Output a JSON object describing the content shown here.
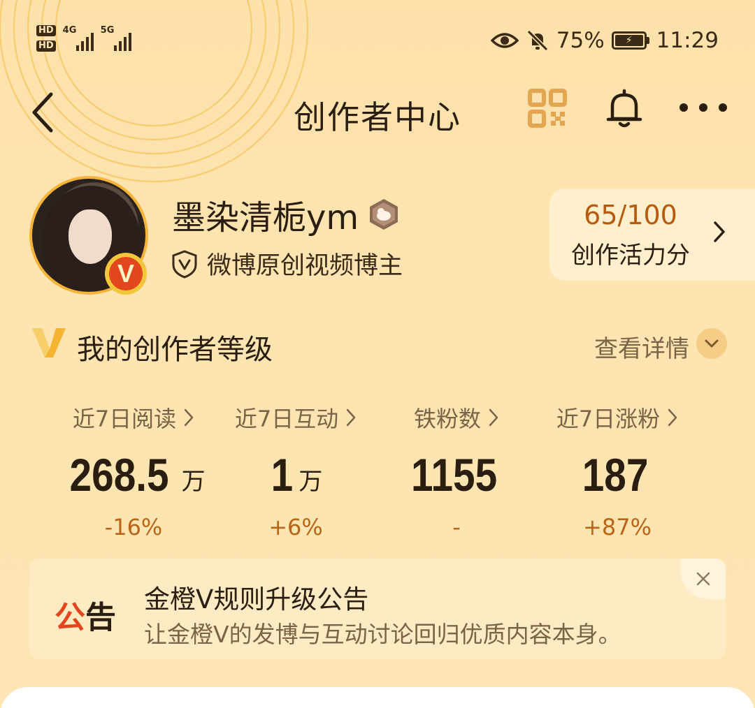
{
  "status_bar": {
    "hd1": "HD",
    "hd2": "HD",
    "net1": "4G",
    "net2": "5G",
    "battery_percent": "75%",
    "time": "11:29"
  },
  "nav": {
    "title": "创作者中心"
  },
  "profile": {
    "username": "墨染清栀ym",
    "verified_badge": "V",
    "verification": "微博原创视频博主"
  },
  "vitality": {
    "score": "65/100",
    "label": "创作活力分"
  },
  "level": {
    "title": "我的创作者等级",
    "detail_label": "查看详情"
  },
  "stats": [
    {
      "label": "近7日阅读",
      "value": "268.5",
      "unit": "万",
      "change": "-16%"
    },
    {
      "label": "近7日互动",
      "value": "1",
      "unit": "万",
      "change": "+6%"
    },
    {
      "label": "铁粉数",
      "value": "1155",
      "unit": "",
      "change": "-"
    },
    {
      "label": "近7日涨粉",
      "value": "187",
      "unit": "",
      "change": "+87%"
    }
  ],
  "notice": {
    "tag_part1": "公",
    "tag_part2": "告",
    "title": "金橙V规则升级公告",
    "body": "让金橙V的发博与互动讨论回归优质内容本身。"
  },
  "colors": {
    "background": "#fde2ae",
    "accent_orange": "#b55a0f",
    "brand_red": "#e2461d",
    "text_dark": "#2a1e10"
  },
  "icons": [
    "back-icon",
    "qr-code-icon",
    "bell-icon",
    "more-icon",
    "chevron-right-icon",
    "chevron-down-icon",
    "close-icon",
    "shield-v-icon",
    "level-v-icon"
  ]
}
